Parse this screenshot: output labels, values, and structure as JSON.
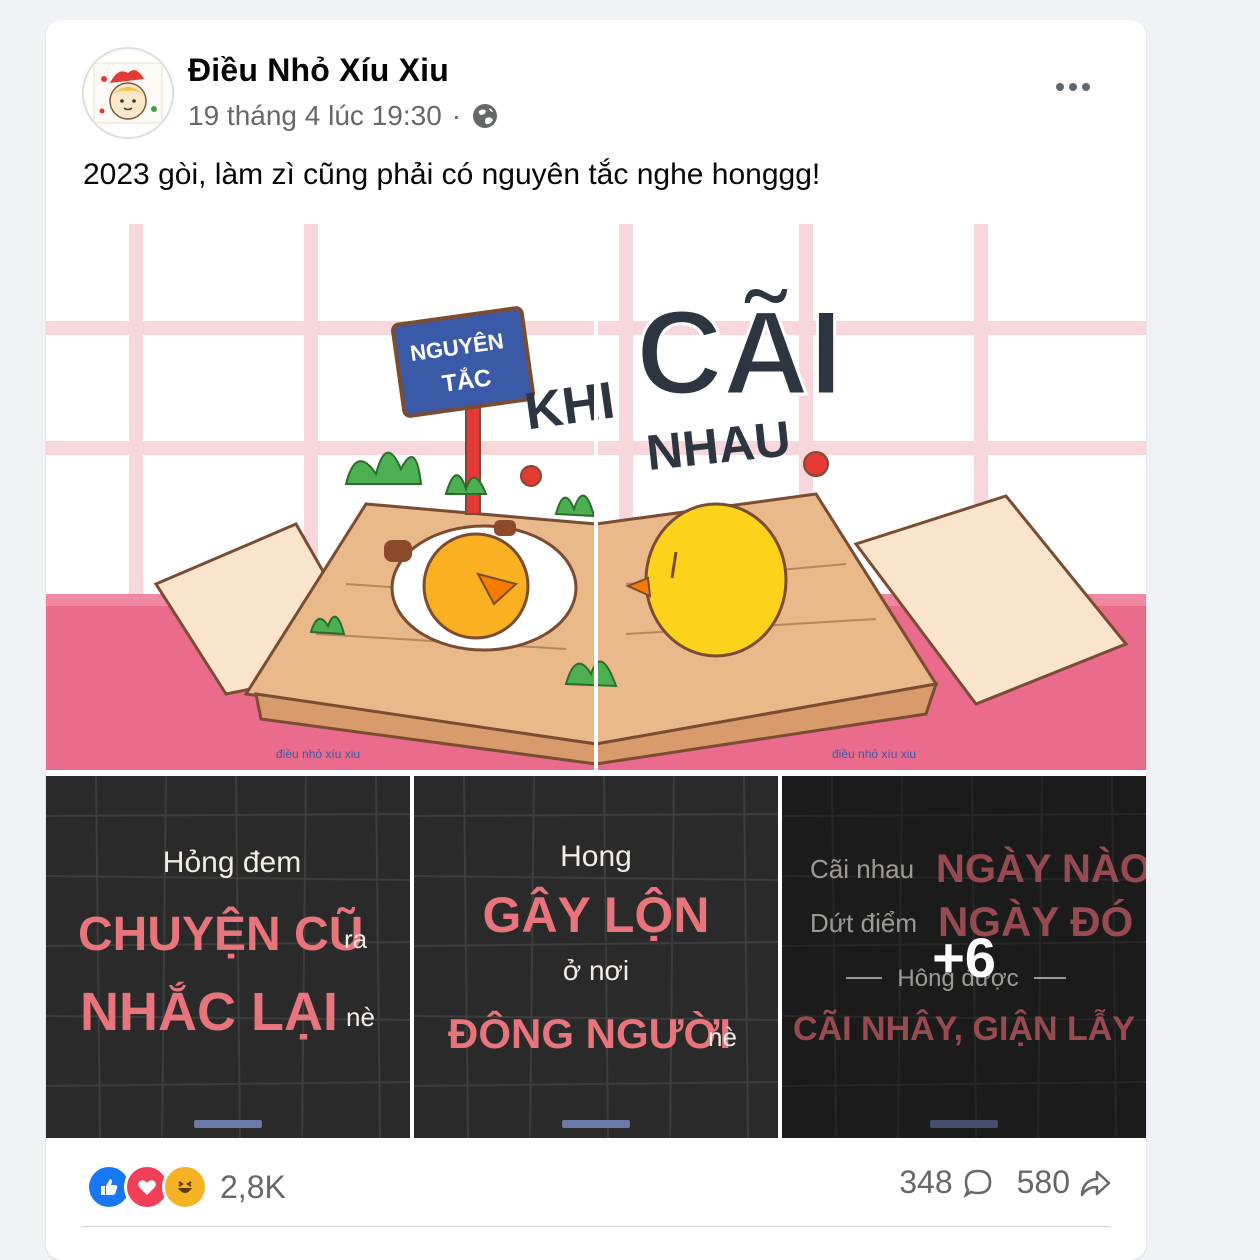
{
  "post": {
    "author": "Điều Nhỏ Xíu Xiu",
    "timestamp": "19 tháng 4 lúc 19:30",
    "separator": "·",
    "privacy_icon": "globe-icon",
    "caption": "2023 gòi, làm zì cũng phải có nguyên tắc nghe honggg!"
  },
  "hero_image": {
    "sign_line1": "NGUYÊN",
    "sign_line2": "TẮC",
    "word_khi": "KHI",
    "word_cai": "CÃI",
    "word_nhau": "NHAU",
    "watermark": "điều nhỏ xíu xiu"
  },
  "thumbnails": [
    {
      "line1": "Hỏng đem",
      "line2": "CHUYỆN CŨ",
      "line2_suffix": "ra",
      "line3": "NHẮC LẠI",
      "line3_suffix": "nè"
    },
    {
      "line1": "Hong",
      "line2": "GÂY LỘN",
      "line3": "ở nơi",
      "line4": "ĐÔNG NGƯỜI",
      "line4_suffix": "nè"
    },
    {
      "line1_prefix": "Cãi nhau",
      "line1": "NGÀY NÀO",
      "line2_prefix": "Dứt điểm",
      "line2": "NGÀY ĐÓ",
      "line3": "Hông được",
      "line4": "CÃI NHÂY, GIẬN LẪY",
      "more_count": "+6"
    }
  ],
  "stats": {
    "reaction_icons": [
      "like-icon",
      "love-icon",
      "haha-icon"
    ],
    "reaction_count": "2,8K",
    "comment_count": "348",
    "share_count": "580"
  },
  "colors": {
    "accent_blue": "#1877f2",
    "love_red": "#f33e58",
    "haha_yellow": "#f7b125",
    "text_secondary": "#65676b",
    "dark_bg": "#2a2a2a",
    "pink_text": "#e8747c"
  }
}
